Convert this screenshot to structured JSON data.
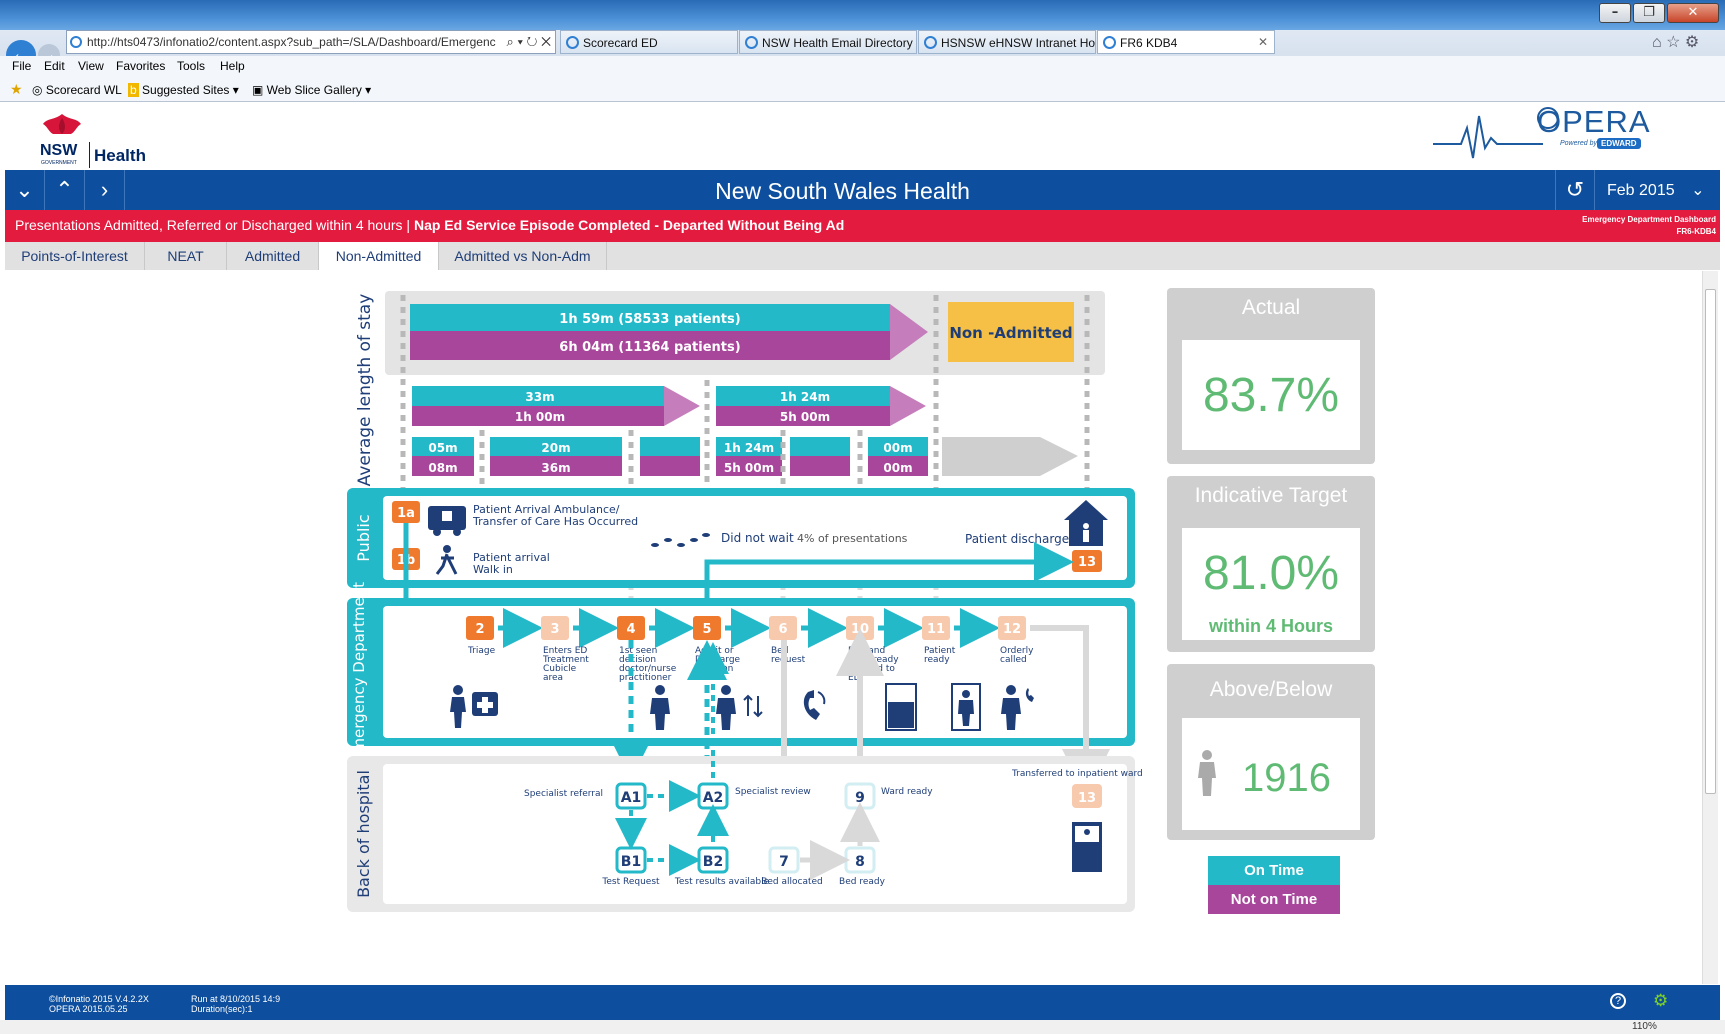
{
  "browser": {
    "address": "http://hts0473/infonatio2/content.aspx?sub_path=/SLA/Dashboard/Emergenc",
    "tabs": [
      "Scorecard ED",
      "NSW Health Email Directory",
      "HSNSW eHNSW Intranet Ho...",
      "FR6 KDB4"
    ],
    "menu": [
      "File",
      "Edit",
      "View",
      "Favorites",
      "Tools",
      "Help"
    ],
    "favorites": [
      "Scorecard WL",
      "Suggested Sites",
      "Web Slice Gallery"
    ],
    "zoom": "110%"
  },
  "header": {
    "nsw": "NSW",
    "nsw_sub": "GOVERNMENT",
    "health": "Health",
    "opera": "OPERA",
    "opera_powered": "Powered by",
    "opera_edward": "EDWARD",
    "title": "New South Wales Health",
    "period": "Feb 2015"
  },
  "redbar": {
    "left": "Presentations Admitted, Referred or Discharged within 4 hours |",
    "left_bold": "Nap Ed Service Episode Completed - Departed Without Being Ad",
    "right1": "Emergency Department Dashboard",
    "right2": "FR6-KDB4"
  },
  "page_tabs": [
    "Points-of-Interest",
    "NEAT",
    "Admitted",
    "Non-Admitted",
    "Admitted vs Non-Adm"
  ],
  "diagram": {
    "side_labels": {
      "los": "Average length of stay",
      "public": "Public",
      "ed": "Emergency Department",
      "back": "Back of hospital"
    },
    "top_teal": "1h 59m (58533 patients)",
    "top_purple": "6h 04m (11364 patients)",
    "non_admitted": "Non -Admitted",
    "mid1_teal": "33m",
    "mid1_purple": "1h 00m",
    "mid2_teal": "1h 24m",
    "mid2_purple": "5h 00m",
    "seg": [
      {
        "t": "05m",
        "p": "08m"
      },
      {
        "t": "20m",
        "p": "36m"
      },
      {
        "t": "",
        "p": ""
      },
      {
        "t": "1h 24m",
        "p": "5h 00m"
      },
      {
        "t": "",
        "p": ""
      },
      {
        "t": "00m",
        "p": "00m"
      }
    ],
    "public": {
      "n1a": "1a",
      "arrival_amb": "Patient Arrival Ambulance/",
      "arrival_amb2": "Transfer of Care Has Occurred",
      "n1b": "1b",
      "walk1": "Patient arrival",
      "walk2": "Walk in",
      "dnw": "Did not wait",
      "dnw_pct": "4% of presentations",
      "discharge": "Patient discharge",
      "n13": "13"
    },
    "ed_steps": [
      {
        "n": "2",
        "label": "Triage"
      },
      {
        "n": "3",
        "label": "Enters ED Treatment Cubicle area"
      },
      {
        "n": "4",
        "label": "1st seen decision doctor/nurse practitioner"
      },
      {
        "n": "5",
        "label": "Admit or Discharge Decision"
      },
      {
        "n": "6",
        "label": "Bed request"
      },
      {
        "n": "10",
        "label": "Bed and ward ready advised to ED"
      },
      {
        "n": "11",
        "label": "Patient ready"
      },
      {
        "n": "12",
        "label": "Orderly called"
      }
    ],
    "back": {
      "a1": "A1",
      "a1_label": "Specialist referral",
      "a2": "A2",
      "a2_label": "Specialist review",
      "b1": "B1",
      "b1_label": "Test Request",
      "b2": "B2",
      "b2_label": "Test results available",
      "n7": "7",
      "n7_label": "Bed allocated",
      "n8": "8",
      "n8_label": "Bed ready",
      "n9": "9",
      "n9_label": "Ward ready",
      "n13": "13",
      "n13_label": "Transferred to inpatient ward"
    }
  },
  "kpi": {
    "actual_title": "Actual",
    "actual_value": "83.7%",
    "target_title": "Indicative Target",
    "target_value": "81.0%",
    "target_sub": "within 4 Hours",
    "ab_title": "Above/Below",
    "ab_value": "1916",
    "legend_on": "On Time",
    "legend_not": "Not on Time",
    "color_on": "#23b9c8",
    "color_not": "#a8469b",
    "value_color": "#5fbb74"
  },
  "footer": {
    "l1": "©Infonatio 2015 V.4.2.2X",
    "l2": "OPERA 2015.05.25",
    "r1": "Run at 8/10/2015 14:9",
    "r2": "Duration(sec):1"
  }
}
